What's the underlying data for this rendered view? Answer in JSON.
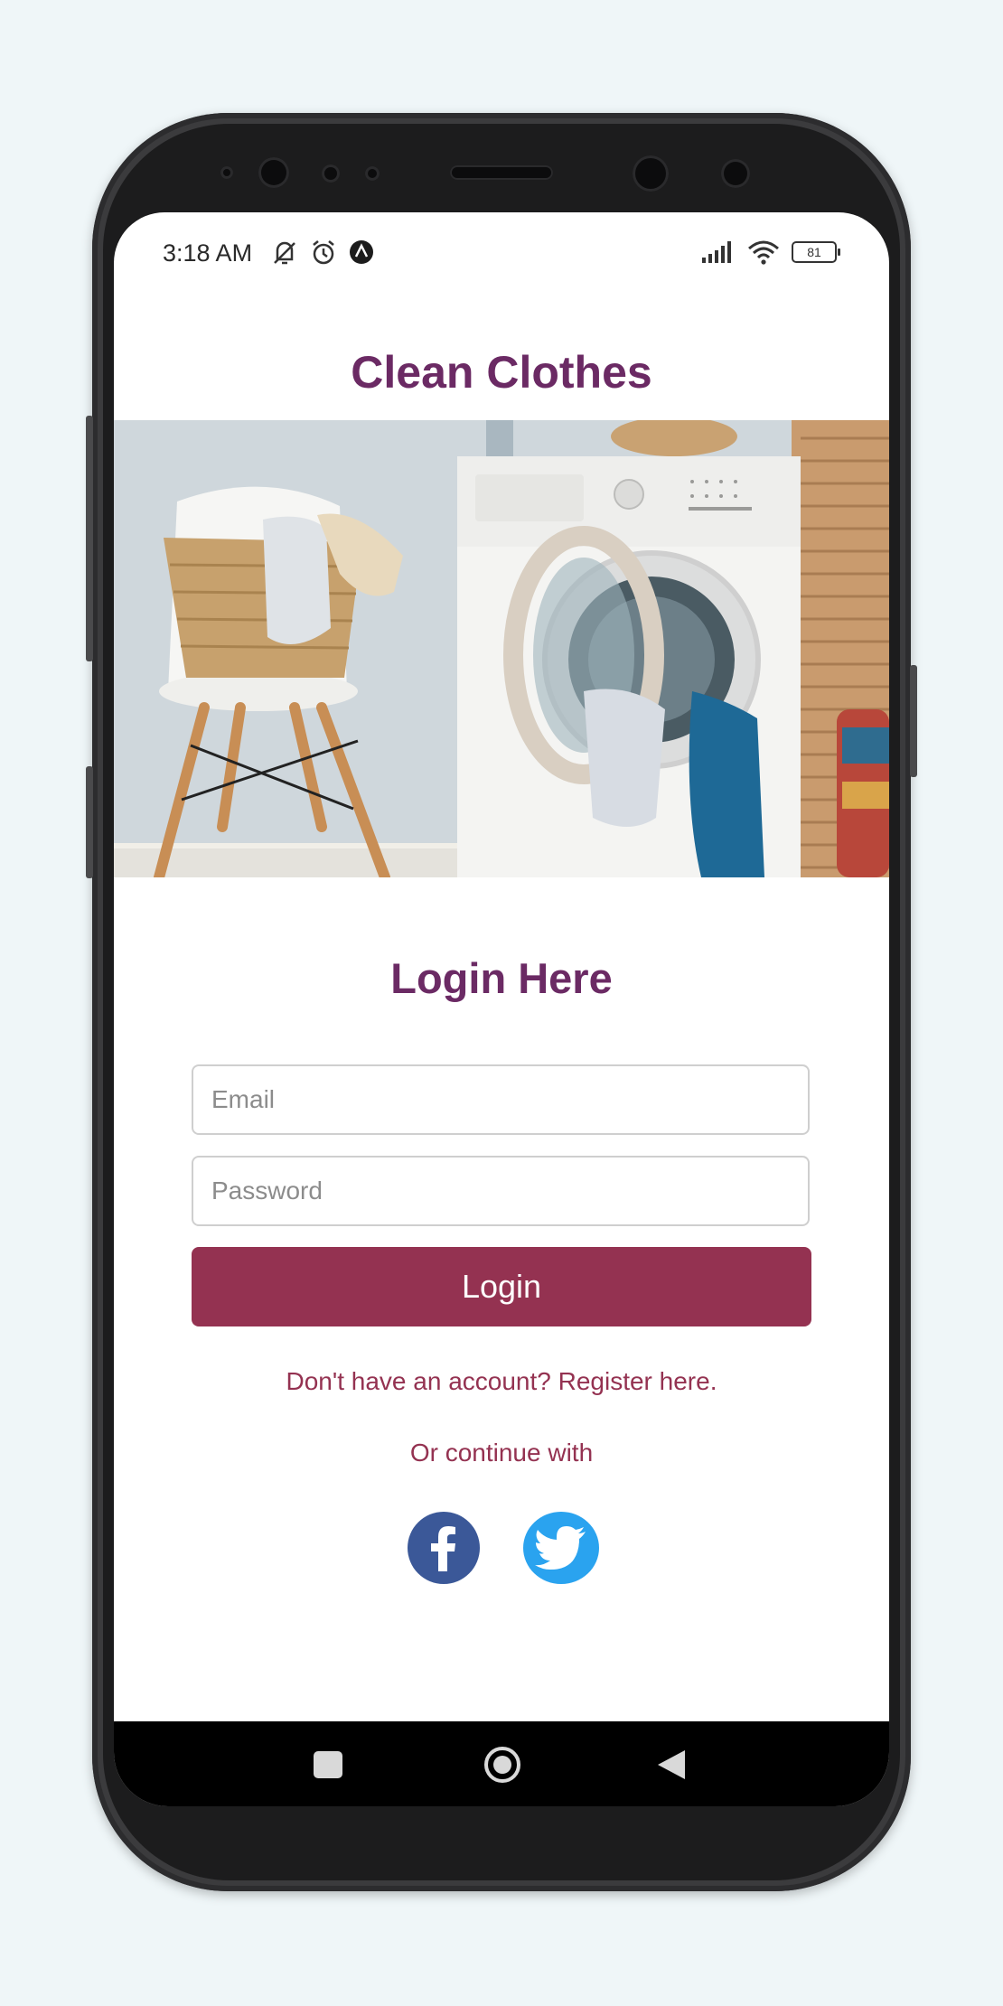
{
  "status_bar": {
    "time": "3:18 AM",
    "battery": "81",
    "icons_left": [
      "mute-icon",
      "alarm-icon",
      "notification-icon"
    ],
    "icons_right": [
      "signal-icon",
      "wifi-icon",
      "battery-icon"
    ]
  },
  "app": {
    "title": "Clean Clothes"
  },
  "login": {
    "heading": "Login Here",
    "email_placeholder": "Email",
    "password_placeholder": "Password",
    "button_label": "Login",
    "register_text": "Don't have an account? Register here.",
    "continue_text": "Or continue with"
  },
  "social": [
    {
      "name": "facebook",
      "icon": "facebook-icon",
      "color": "#3b5898"
    },
    {
      "name": "twitter",
      "icon": "twitter-icon",
      "color": "#2aa3ef"
    }
  ],
  "nav": {
    "icons": [
      "recents-square-icon",
      "home-circle-icon",
      "back-triangle-icon"
    ]
  },
  "colors": {
    "title": "#6b2a64",
    "accent": "#943251",
    "background": "#eff6f8"
  }
}
